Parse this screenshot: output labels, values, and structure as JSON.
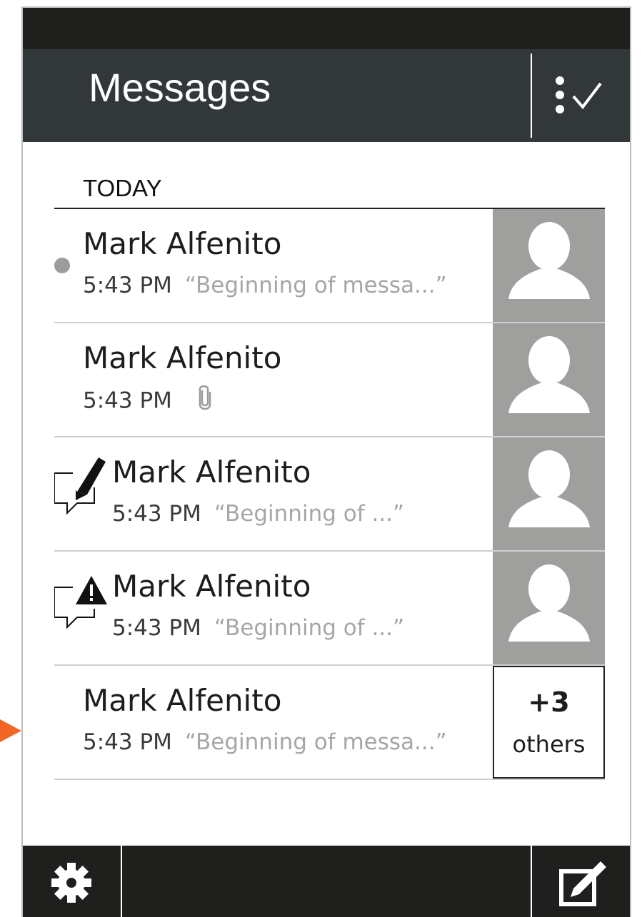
{
  "header": {
    "title": "Messages"
  },
  "section": {
    "label": "TODAY"
  },
  "messages": [
    {
      "name": "Mark Alfenito",
      "time": "5:43 PM",
      "snippet": "“Beginning of messa...”",
      "status": "unread",
      "avatar": "person-silhouette"
    },
    {
      "name": "Mark Alfenito",
      "time": "5:43 PM",
      "snippet": "",
      "status": "attachment",
      "avatar": "person-silhouette"
    },
    {
      "name": "Mark Alfenito",
      "time": "5:43 PM",
      "snippet": "“Beginning of ...”",
      "status": "draft",
      "avatar": "person-silhouette"
    },
    {
      "name": "Mark Alfenito",
      "time": "5:43 PM",
      "snippet": "“Beginning of ...”",
      "status": "error",
      "avatar": "person-silhouette"
    },
    {
      "name": "Mark Alfenito",
      "time": "5:43 PM",
      "snippet": "“Beginning of messa...”",
      "status": "group",
      "others_count": "+3",
      "others_label": "others"
    }
  ],
  "icons": {
    "select": "select-check-icon",
    "settings": "gear-icon",
    "compose": "compose-icon",
    "attachment": "paperclip-icon",
    "draft": "draft-pencil-icon",
    "error": "alert-triangle-icon",
    "pointer": "pointer-arrow-icon"
  },
  "colors": {
    "status_bar": "#1f1f1d",
    "header": "#32383a",
    "avatar_bg": "#9f9f9e",
    "snippet": "#a6a6a6",
    "unread_dot": "#9c9c9c",
    "pointer": "#f26522"
  }
}
